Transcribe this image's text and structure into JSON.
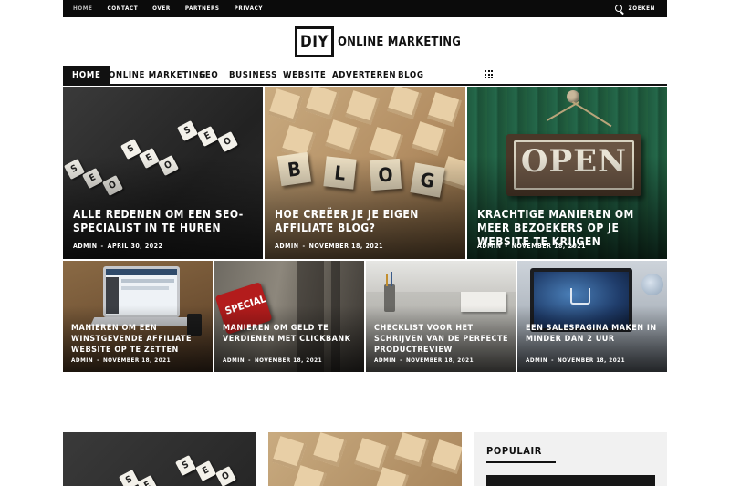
{
  "topbar": {
    "menu": [
      "HOME",
      "CONTACT",
      "OVER",
      "PARTNERS",
      "PRIVACY"
    ],
    "search_label": "ZOEKEN"
  },
  "logo": {
    "box_text": "DIY",
    "text": "ONLINE MARKETING"
  },
  "nav": {
    "items": [
      "HOME",
      "ONLINE MARKETING",
      "SEO",
      "BUSINESS",
      "WEBSITE",
      "ADVERTEREN",
      "BLOG"
    ],
    "active": "HOME"
  },
  "featured": [
    {
      "title": "ALLE REDENEN OM EEN SEO-SPECIALIST IN TE HUREN",
      "author": "ADMIN",
      "date": "APRIL 30, 2022"
    },
    {
      "title": "HOE CREËER JE JE EIGEN AFFILIATE BLOG?",
      "author": "ADMIN",
      "date": "NOVEMBER 18, 2021"
    },
    {
      "title": "KRACHTIGE MANIEREN OM MEER BEZOEKERS OP JE WEBSITE TE KRIJGEN",
      "author": "ADMIN",
      "date": "NOVEMBER 18, 2021"
    }
  ],
  "secondary": [
    {
      "title": "MANIEREN OM EEN WINSTGEVENDE AFFILIATE WEBSITE OP TE ZETTEN",
      "author": "ADMIN",
      "date": "NOVEMBER 18, 2021"
    },
    {
      "title": "MANIEREN OM GELD TE VERDIENEN MET CLICKBANK",
      "author": "ADMIN",
      "date": "NOVEMBER 18, 2021"
    },
    {
      "title": "CHECKLIST VOOR HET SCHRIJVEN VAN DE PERFECTE PRODUCTREVIEW",
      "author": "ADMIN",
      "date": "NOVEMBER 18, 2021"
    },
    {
      "title": "EEN SALESPAGINA MAKEN IN MINDER DAN 2 UUR",
      "author": "ADMIN",
      "date": "NOVEMBER 18, 2021"
    }
  ],
  "image_text": {
    "seo_letters": [
      "S",
      "E",
      "O",
      "S",
      "E",
      "O",
      "S",
      "E",
      "O"
    ],
    "blog_letters": [
      "B",
      "L",
      "O",
      "G"
    ],
    "open_sign": "OPEN",
    "special_sign": "SPECIAL"
  },
  "sidebar": {
    "heading": "POPULAIR"
  }
}
